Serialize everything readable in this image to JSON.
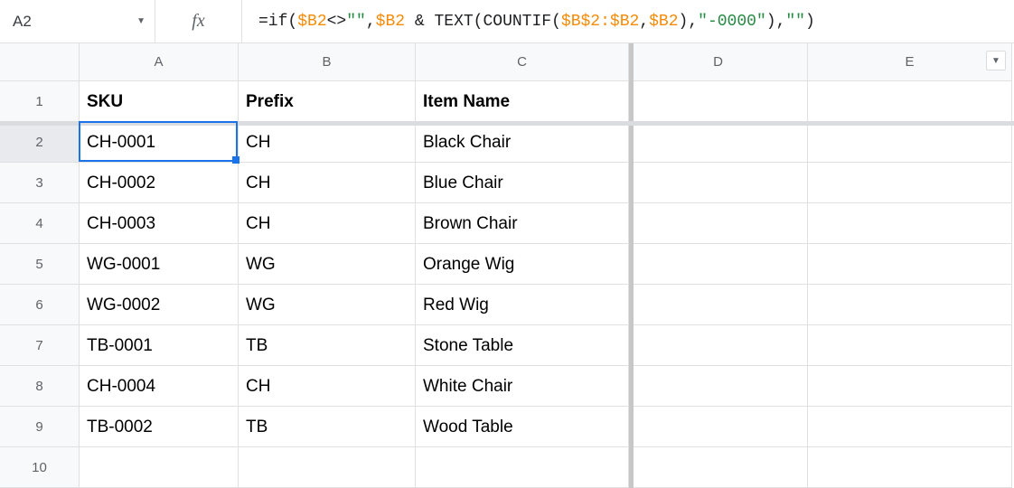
{
  "nameBox": {
    "cellRef": "A2"
  },
  "formula": {
    "tokens": [
      {
        "t": "fn",
        "v": "=if"
      },
      {
        "t": "fn",
        "v": "("
      },
      {
        "t": "ref",
        "v": "$B2"
      },
      {
        "t": "fn",
        "v": "<>"
      },
      {
        "t": "str",
        "v": "\"\""
      },
      {
        "t": "fn",
        "v": ","
      },
      {
        "t": "ref",
        "v": "$B2"
      },
      {
        "t": "fn",
        "v": " & TEXT(COUNTIF("
      },
      {
        "t": "ref",
        "v": "$B$2:$B2"
      },
      {
        "t": "fn",
        "v": ","
      },
      {
        "t": "ref",
        "v": "$B2"
      },
      {
        "t": "fn",
        "v": "),"
      },
      {
        "t": "str",
        "v": "\"-0000\""
      },
      {
        "t": "fn",
        "v": "),"
      },
      {
        "t": "str",
        "v": "\"\""
      },
      {
        "t": "fn",
        "v": ")"
      }
    ]
  },
  "columns": [
    "A",
    "B",
    "C",
    "D",
    "E"
  ],
  "rowNumbers": [
    1,
    2,
    3,
    4,
    5,
    6,
    7,
    8,
    9,
    10
  ],
  "headerRow": {
    "A": "SKU",
    "B": "Prefix",
    "C": "Item Name",
    "D": "",
    "E": ""
  },
  "dataRows": [
    {
      "A": "CH-0001",
      "B": "CH",
      "C": "Black Chair",
      "D": "",
      "E": ""
    },
    {
      "A": "CH-0002",
      "B": "CH",
      "C": "Blue Chair",
      "D": "",
      "E": ""
    },
    {
      "A": "CH-0003",
      "B": "CH",
      "C": "Brown Chair",
      "D": "",
      "E": ""
    },
    {
      "A": "WG-0001",
      "B": "WG",
      "C": "Orange Wig",
      "D": "",
      "E": ""
    },
    {
      "A": "WG-0002",
      "B": "WG",
      "C": "Red Wig",
      "D": "",
      "E": ""
    },
    {
      "A": "TB-0001",
      "B": "TB",
      "C": "Stone Table",
      "D": "",
      "E": ""
    },
    {
      "A": "CH-0004",
      "B": "CH",
      "C": "White Chair",
      "D": "",
      "E": ""
    },
    {
      "A": "TB-0002",
      "B": "TB",
      "C": "Wood Table",
      "D": "",
      "E": ""
    },
    {
      "A": "",
      "B": "",
      "C": "",
      "D": "",
      "E": ""
    }
  ],
  "selection": {
    "row": 2,
    "col": "A"
  }
}
